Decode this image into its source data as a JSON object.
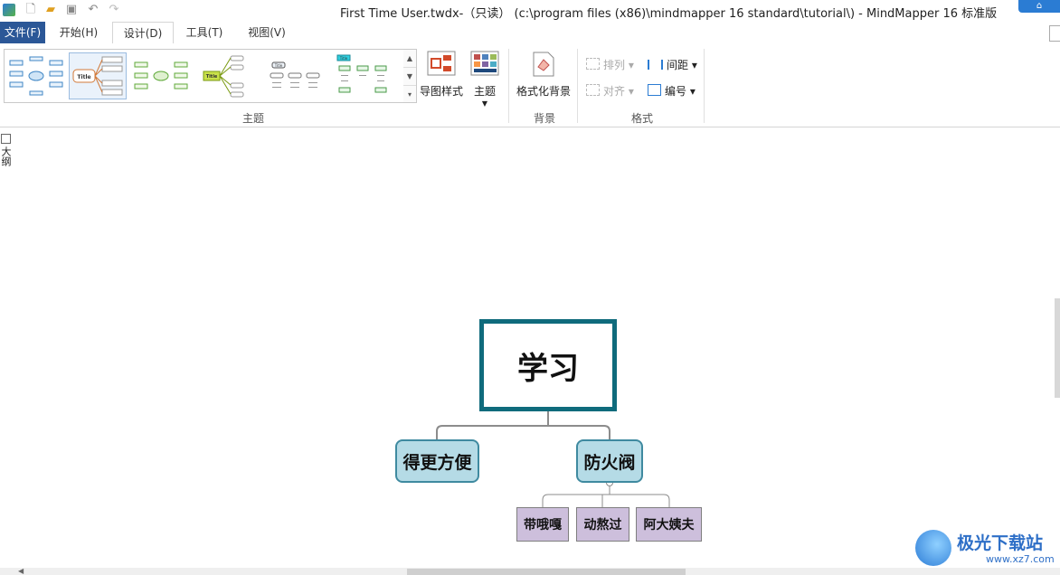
{
  "window": {
    "title": "First Time User.twdx-（只读） (c:\\program files (x86)\\mindmapper 16 standard\\tutorial\\) - MindMapper 16 标准版",
    "help_glyph": "⌂"
  },
  "quick_access": {
    "icons": [
      "new-file-icon",
      "open-folder-icon",
      "save-icon",
      "undo-icon",
      "redo-icon"
    ]
  },
  "menu": {
    "file": "文件(F)",
    "tabs": [
      "开始(H)",
      "设计(D)",
      "工具(T)",
      "视图(V)"
    ],
    "active": "设计(D)"
  },
  "ribbon": {
    "theme_group_label": "主题",
    "map_style_label": "导图样式",
    "theme_label": "主题",
    "background_group_label": "背景",
    "format_background_label": "格式化背景",
    "format_group_label": "格式",
    "arrange_label": "排列",
    "align_label": "对齐",
    "spacing_label": "间距",
    "numbering_label": "编号",
    "gallery_thumbnails": [
      "Title",
      "Title",
      "Title",
      "Title",
      "Title",
      "Title"
    ]
  },
  "side_panel": {
    "label": "大纲"
  },
  "mindmap": {
    "root": "学习",
    "branches": [
      {
        "label": "得更方便",
        "children": []
      },
      {
        "label": "防火阀",
        "children": [
          "带哦嘎",
          "动熬过",
          "阿大姨夫"
        ]
      }
    ],
    "colors": {
      "root_border": "#0f6b7c",
      "main_fill": "#b5dbe6",
      "main_border": "#3f8aa0",
      "sub_fill": "#cdbfdc",
      "connector": "#8c8c8c"
    }
  },
  "watermark": {
    "text": "极光下载站",
    "url": "www.xz7.com"
  }
}
